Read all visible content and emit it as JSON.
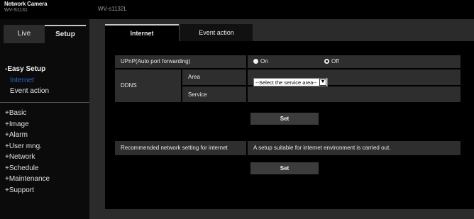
{
  "header": {
    "product_name": "Network Camera",
    "product_model": "WV-S1131",
    "camera_title": "WV-s1132L"
  },
  "sidebar": {
    "modes": [
      "Live",
      "Setup"
    ],
    "easy_setup": {
      "heading": "-Easy Setup",
      "items": [
        {
          "label": "Internet",
          "active": true
        },
        {
          "label": "Event action",
          "active": false
        }
      ]
    },
    "menu": [
      "+Basic",
      "+Image",
      "+Alarm",
      "+User mng.",
      "+Network",
      "+Schedule",
      "+Maintenance",
      "+Support"
    ]
  },
  "tabs": [
    "Internet",
    "Event action"
  ],
  "form": {
    "upnp": {
      "label": "UPnP(Auto port forwarding)",
      "on_label": "On",
      "off_label": "Off",
      "selected": "On"
    },
    "ddns": {
      "label": "DDNS",
      "area_label": "Area",
      "area_value": "--Select the service area--",
      "service_label": "Service",
      "service_value": ""
    },
    "set_label": "Set",
    "recommended": {
      "label": "Recommended network setting for internet",
      "description": "A setup suitable for internet environment is carried out.",
      "set_label": "Set"
    }
  },
  "colors": {
    "active_link": "#2a62c9",
    "panel_bg": "#000000",
    "content_bg": "#2b2b2b",
    "row_bg": "#2e2e2e"
  }
}
